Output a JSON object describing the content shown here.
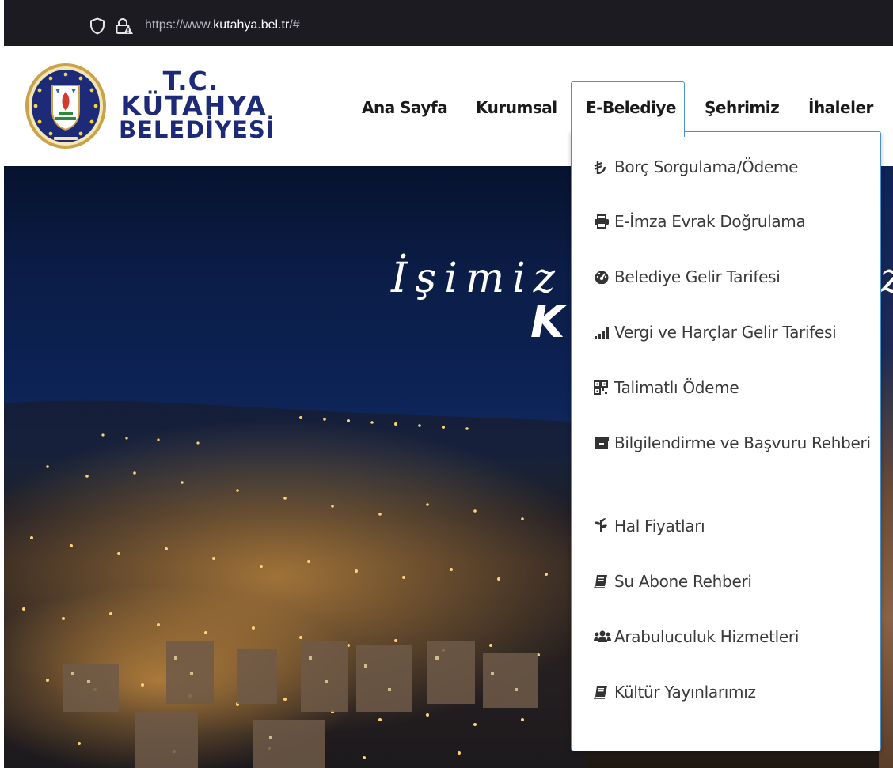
{
  "browser": {
    "url_prefix": "https://www.",
    "url_domain": "kutahya.bel.tr",
    "url_suffix": "/#",
    "icons": [
      "shield-icon",
      "lock-warning-icon"
    ]
  },
  "logo": {
    "line1": "T.C.",
    "line2": "KÜTAHYA",
    "line3": "BELEDİYESİ",
    "emblem_caption": "KÜTAHYA BELEDİYESİ"
  },
  "nav": {
    "items": [
      {
        "label": "Ana Sayfa"
      },
      {
        "label": "Kurumsal"
      },
      {
        "label": "E-Belediye",
        "active": true
      },
      {
        "label": "Şehrimiz"
      },
      {
        "label": "İhaleler"
      }
    ]
  },
  "hero": {
    "slogan_visible": "İşimiz",
    "slogan_line2_visible": "K",
    "slogan_tail_visible": "z"
  },
  "dropdown": {
    "items": [
      {
        "icon": "lira-icon",
        "label": "Borç Sorgulama/Ödeme"
      },
      {
        "icon": "printer-icon",
        "label": "E-İmza Evrak Doğrulama"
      },
      {
        "icon": "dashboard-icon",
        "label": "Belediye Gelir Tarifesi"
      },
      {
        "icon": "signal-icon",
        "label": "Vergi ve Harçlar Gelir Tarifesi"
      },
      {
        "icon": "qrcode-icon",
        "label": "Talimatlı Ödeme"
      },
      {
        "icon": "archive-icon",
        "label": "Bilgilendirme ve Başvuru Rehberi"
      },
      {
        "icon": "pagelines-icon",
        "label": "Hal Fiyatları"
      },
      {
        "icon": "book-icon",
        "label": "Su Abone Rehberi"
      },
      {
        "icon": "users-icon",
        "label": "Arabuluculuk Hizmetleri"
      },
      {
        "icon": "book-icon",
        "label": "Kültür Yayınlarımız"
      }
    ]
  },
  "colors": {
    "brand_navy": "#1d2a78",
    "active_border": "#4a90c9",
    "urlbar_bg": "#1c1b22"
  }
}
